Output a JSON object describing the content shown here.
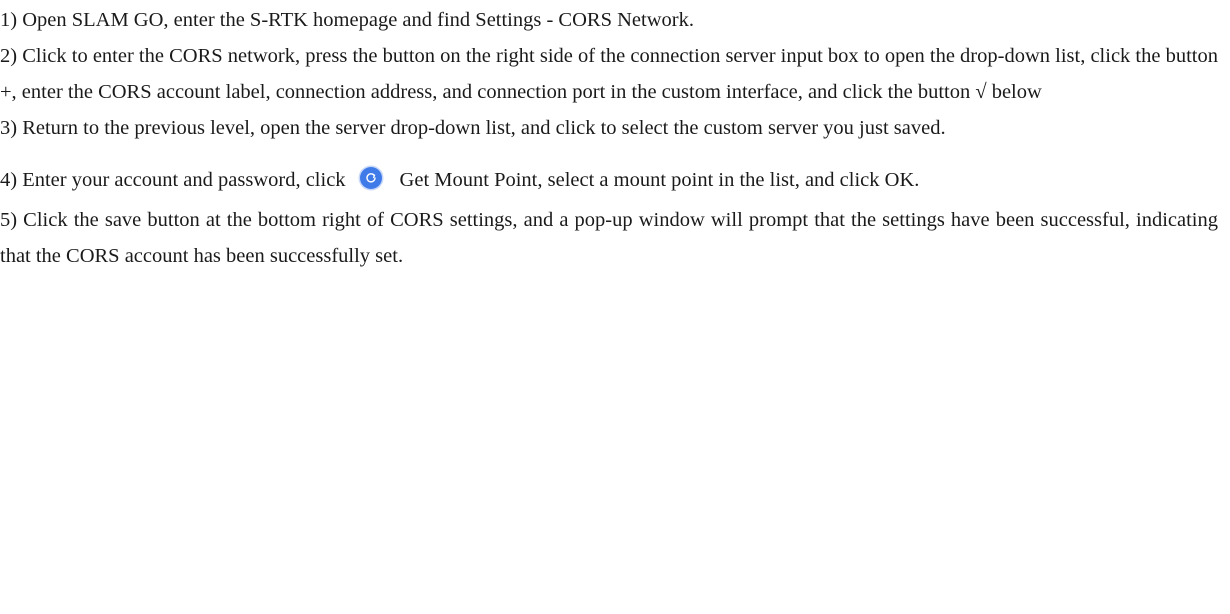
{
  "steps": [
    {
      "text": "1)  Open SLAM GO, enter the S-RTK homepage and find Settings - CORS Network."
    },
    {
      "text": "2)  Click to enter the CORS network, press the button on the right side of the connection server input box to open the drop-down list, click the button +, enter the CORS account label, connection address, and connection port in the custom interface, and click the button √ below"
    },
    {
      "text": "3)  Return to the previous level, open the server drop-down list, and click to select the custom server you just saved."
    },
    {
      "text_before_icon": "4)  Enter your account and password, click",
      "icon": "refresh-icon",
      "text_after_icon": "Get Mount Point, select a mount point in the list, and click OK."
    },
    {
      "text": "5)  Click the save button at the bottom right of CORS settings, and a pop-up window will prompt that the settings have been successful, indicating that the CORS account has been successfully set."
    }
  ],
  "colors": {
    "text": "#1a1a1a",
    "icon_fill": "#3f7be8"
  }
}
